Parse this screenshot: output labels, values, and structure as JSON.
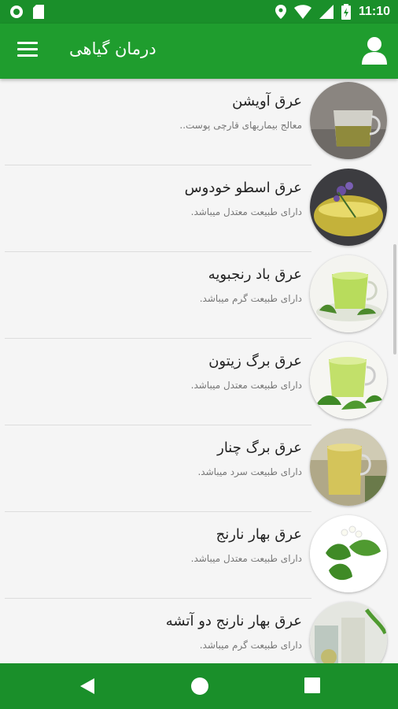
{
  "status": {
    "time": "11:10"
  },
  "app_bar": {
    "title": "درمان گیاهی"
  },
  "colors": {
    "primary": "#1f9d2e",
    "status": "#1a8f2a",
    "background": "#f5f5f5"
  },
  "items": [
    {
      "title": "عرق آویشن",
      "subtitle": "معالج بیماریهای قارچی پوست.."
    },
    {
      "title": "عرق اسطو خودوس",
      "subtitle": "دارای طبیعت معتدل میباشد."
    },
    {
      "title": "عرق باد رنجبویه",
      "subtitle": "دارای طبیعت گرم میباشد."
    },
    {
      "title": "عرق برگ زیتون",
      "subtitle": "دارای طبیعت معتدل میباشد."
    },
    {
      "title": "عرق برگ چنار",
      "subtitle": "دارای طبیعت سرد میباشد."
    },
    {
      "title": "عرق بهار نارنج",
      "subtitle": "دارای طبیعت معتدل میباشد."
    },
    {
      "title": "عرق بهار نارنج دو آتشه",
      "subtitle": "دارای طبیعت گرم میباشد."
    }
  ],
  "icons": {
    "menu": "hamburger-menu-icon",
    "account": "account-icon",
    "back": "back-icon",
    "home": "home-icon",
    "recents": "recents-icon"
  }
}
